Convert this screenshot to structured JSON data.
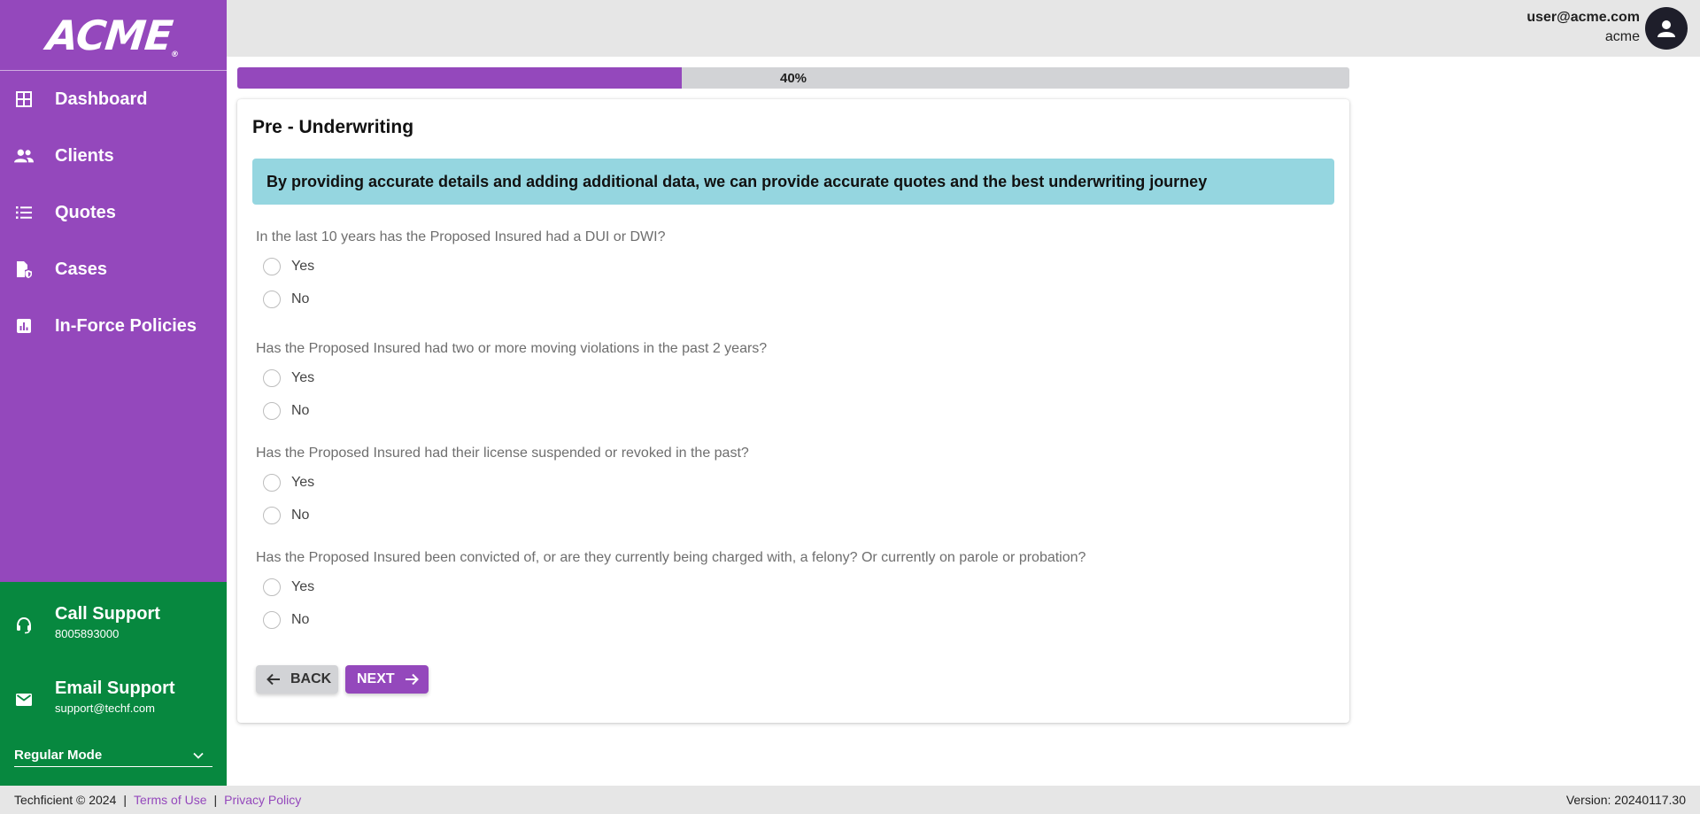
{
  "brand": {
    "logo_text": "ACME",
    "logo_mark": "®",
    "accent_color": "#9448bc",
    "support_color": "#07883f"
  },
  "sidebar": {
    "items": [
      {
        "label": "Dashboard",
        "icon": "grid-icon"
      },
      {
        "label": "Clients",
        "icon": "people-icon"
      },
      {
        "label": "Quotes",
        "icon": "list-icon"
      },
      {
        "label": "Cases",
        "icon": "case-file-icon"
      },
      {
        "label": "In-Force Policies",
        "icon": "bar-chart-icon"
      }
    ],
    "support": {
      "call_title": "Call Support",
      "call_value": "8005893000",
      "email_title": "Email Support",
      "email_value": "support@techf.com"
    },
    "mode": {
      "selected": "Regular Mode"
    }
  },
  "header": {
    "user_email": "user@acme.com",
    "user_org": "acme"
  },
  "progress": {
    "value": 0.4,
    "label": "40%"
  },
  "form": {
    "title": "Pre - Underwriting",
    "notice": "By providing accurate details and adding additional data, we can provide accurate quotes and the best underwriting journey",
    "questions": [
      {
        "text": "In the last 10 years has the Proposed Insured had a DUI or DWI?",
        "options": [
          "Yes",
          "No"
        ]
      },
      {
        "text": "Has the Proposed Insured had two or more moving violations in the past 2 years?",
        "options": [
          "Yes",
          "No"
        ]
      },
      {
        "text": "Has the Proposed Insured had their license suspended or revoked in the past?",
        "options": [
          "Yes",
          "No"
        ]
      },
      {
        "text": "Has the Proposed Insured been convicted of, or are they currently being charged with, a felony? Or currently on parole or probation?",
        "options": [
          "Yes",
          "No"
        ]
      }
    ],
    "back_label": "BACK",
    "next_label": "NEXT"
  },
  "footer": {
    "copyright": "Techficient © 2024",
    "terms": "Terms of Use",
    "privacy": "Privacy Policy",
    "version": "Version: 20240117.30"
  }
}
